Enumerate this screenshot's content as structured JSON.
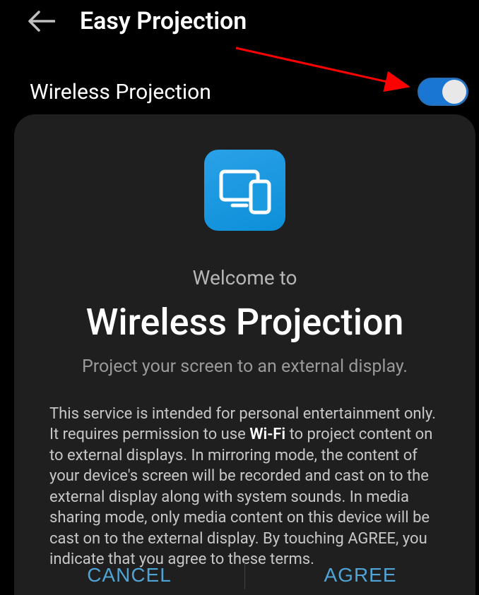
{
  "header": {
    "title": "Easy Projection"
  },
  "setting": {
    "label": "Wireless Projection",
    "enabled": true
  },
  "dialog": {
    "welcome": "Welcome to",
    "title": "Wireless Projection",
    "subtitle": "Project your screen to an external display.",
    "body_pre": "This service is intended for personal entertainment only. It requires permission to use ",
    "body_bold": "Wi-Fi",
    "body_post": " to project content on to external displays. In mirroring mode, the content of your device's screen will be recorded and cast on to the external display along with system sounds. In media sharing mode, only media content on this device will be cast on to the external display. By touching AGREE, you indicate that you agree to these terms.",
    "cancel": "CANCEL",
    "agree": "AGREE"
  },
  "icons": {
    "back": "back-arrow-icon",
    "projection": "screen-cast-icon"
  },
  "colors": {
    "accent": "#1976d2",
    "action_text": "#4fa3d5",
    "annotation": "#ff0000"
  }
}
